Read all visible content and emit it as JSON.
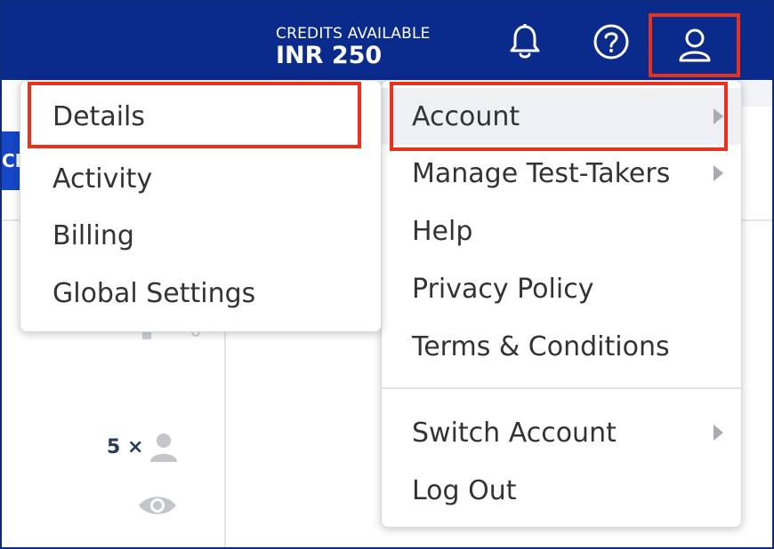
{
  "header": {
    "credits_label": "CREDITS AVAILABLE",
    "credits_value": "INR 250",
    "icons": [
      "bell-icon",
      "help-icon",
      "user-icon"
    ]
  },
  "background": {
    "tab_fragment": "CF",
    "stats_count": "5 ×"
  },
  "menu_left": {
    "items": [
      {
        "label": "Details"
      },
      {
        "label": "Activity"
      },
      {
        "label": "Billing"
      },
      {
        "label": "Global Settings"
      }
    ]
  },
  "menu_right": {
    "items": [
      {
        "label": "Account",
        "has_submenu": true
      },
      {
        "label": "Manage Test-Takers",
        "has_submenu": true
      },
      {
        "label": "Help",
        "has_submenu": false
      },
      {
        "label": "Privacy Policy",
        "has_submenu": false
      },
      {
        "label": "Terms & Conditions",
        "has_submenu": false
      },
      {
        "label": "Switch Account",
        "has_submenu": true
      },
      {
        "label": "Log Out",
        "has_submenu": false
      }
    ]
  },
  "colors": {
    "header_bg": "#0a2b8c",
    "highlight_border": "#e8321e",
    "text": "#333333"
  }
}
